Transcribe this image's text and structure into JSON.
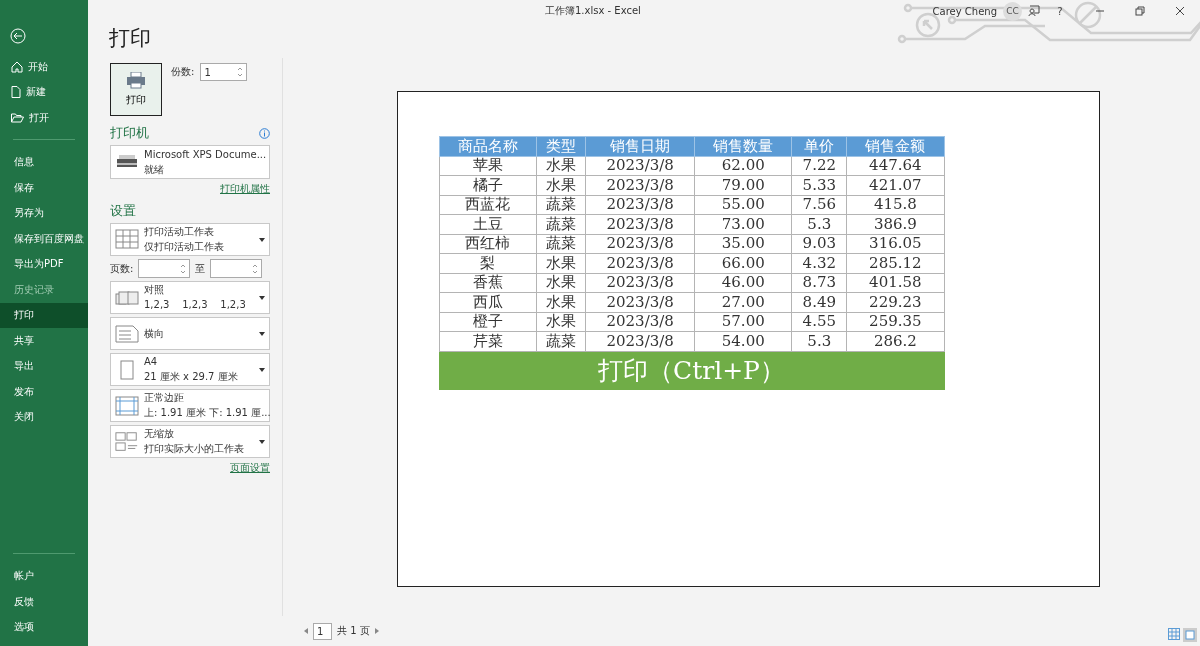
{
  "title_bar": {
    "title": "工作簿1.xlsx  -  Excel",
    "user_name": "Carey Cheng",
    "user_initials": "CC",
    "help": "?"
  },
  "sidebar": {
    "items": [
      {
        "label": "开始",
        "kind": "home",
        "disabled": false,
        "selected": false
      },
      {
        "label": "新建",
        "kind": "file",
        "disabled": false,
        "selected": false
      },
      {
        "label": "打开",
        "kind": "folder",
        "disabled": false,
        "selected": false
      },
      {
        "label": "信息",
        "kind": "plain",
        "disabled": false,
        "selected": false
      },
      {
        "label": "保存",
        "kind": "plain",
        "disabled": false,
        "selected": false
      },
      {
        "label": "另存为",
        "kind": "plain",
        "disabled": false,
        "selected": false
      },
      {
        "label": "保存到百度网盘",
        "kind": "plain",
        "disabled": false,
        "selected": false
      },
      {
        "label": "导出为PDF",
        "kind": "plain",
        "disabled": false,
        "selected": false
      },
      {
        "label": "历史记录",
        "kind": "plain",
        "disabled": true,
        "selected": false
      },
      {
        "label": "打印",
        "kind": "plain",
        "disabled": false,
        "selected": true
      },
      {
        "label": "共享",
        "kind": "plain",
        "disabled": false,
        "selected": false
      },
      {
        "label": "导出",
        "kind": "plain",
        "disabled": false,
        "selected": false
      },
      {
        "label": "发布",
        "kind": "plain",
        "disabled": false,
        "selected": false
      },
      {
        "label": "关闭",
        "kind": "plain",
        "disabled": false,
        "selected": false
      }
    ],
    "bottom_items": [
      "帐户",
      "反馈",
      "选项"
    ]
  },
  "print_panel": {
    "heading": "打印",
    "print_button": "打印",
    "copies_label": "份数:",
    "copies_value": "1",
    "printer": {
      "heading": "打印机",
      "name": "Microsoft XPS Docume...",
      "status": "就绪",
      "link": "打印机属性"
    },
    "settings": {
      "heading": "设置",
      "pages_label": "页数:",
      "to_label": "至",
      "link": "页面设置",
      "dropdowns": [
        {
          "kind": "sheet",
          "line1": "打印活动工作表",
          "line2": "仅打印活动工作表"
        },
        {
          "kind": "collate",
          "line1": "对照",
          "line2": "1,2,3    1,2,3    1,2,3"
        },
        {
          "kind": "orientation",
          "line1": "横向"
        },
        {
          "kind": "paper",
          "line1": "A4",
          "line2": "21 厘米 x 29.7 厘米"
        },
        {
          "kind": "margins",
          "line1": "正常边距",
          "line2": "上: 1.91 厘米 下: 1.91 厘..."
        },
        {
          "kind": "scaling",
          "line1": "无缩放",
          "line2": "打印实际大小的工作表"
        }
      ]
    }
  },
  "preview": {
    "table": {
      "columns": [
        "商品名称",
        "类型",
        "销售日期",
        "销售数量",
        "单价",
        "销售金额"
      ],
      "rows": [
        [
          "苹果",
          "水果",
          "2023/3/8",
          "62.00",
          "7.22",
          "447.64"
        ],
        [
          "橘子",
          "水果",
          "2023/3/8",
          "79.00",
          "5.33",
          "421.07"
        ],
        [
          "西蓝花",
          "蔬菜",
          "2023/3/8",
          "55.00",
          "7.56",
          "415.8"
        ],
        [
          "土豆",
          "蔬菜",
          "2023/3/8",
          "73.00",
          "5.3",
          "386.9"
        ],
        [
          "西红柿",
          "蔬菜",
          "2023/3/8",
          "35.00",
          "9.03",
          "316.05"
        ],
        [
          "梨",
          "水果",
          "2023/3/8",
          "66.00",
          "4.32",
          "285.12"
        ],
        [
          "香蕉",
          "水果",
          "2023/3/8",
          "46.00",
          "8.73",
          "401.58"
        ],
        [
          "西瓜",
          "水果",
          "2023/3/8",
          "27.00",
          "8.49",
          "229.23"
        ],
        [
          "橙子",
          "水果",
          "2023/3/8",
          "57.00",
          "4.55",
          "259.35"
        ],
        [
          "芹菜",
          "蔬菜",
          "2023/3/8",
          "54.00",
          "5.3",
          "286.2"
        ]
      ],
      "banner": "打印（Ctrl+P）"
    },
    "pager": {
      "page": "1",
      "total": "共 1 页"
    }
  }
}
